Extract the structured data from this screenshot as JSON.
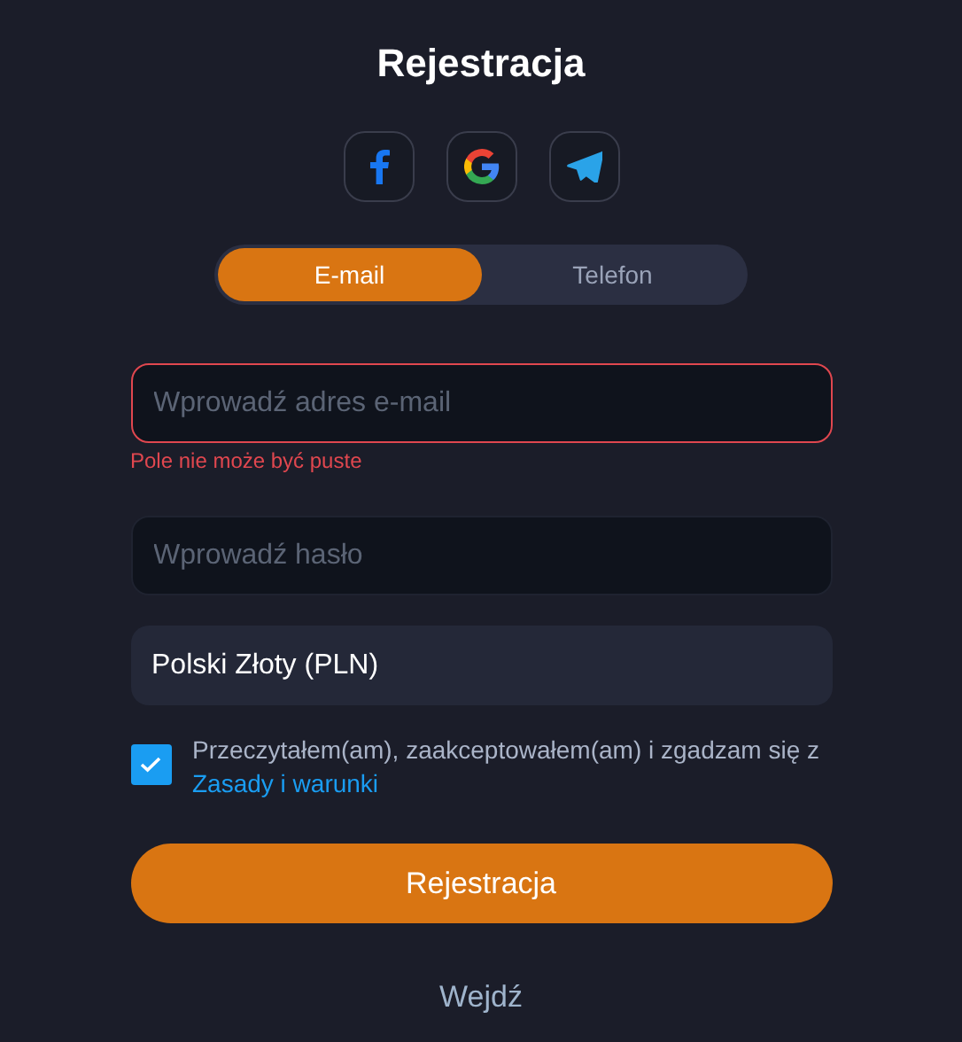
{
  "title": "Rejestracja",
  "social": [
    {
      "kind": "facebook"
    },
    {
      "kind": "google"
    },
    {
      "kind": "telegram"
    }
  ],
  "tabs": [
    {
      "label": "E-mail",
      "selected": true
    },
    {
      "label": "Telefon",
      "selected": false
    }
  ],
  "fields": [
    {
      "kind": "input",
      "placeholder": "Wprowadź adres e-mail",
      "error": "Pole nie może być puste"
    },
    {
      "kind": "input",
      "placeholder": "Wprowadź hasło"
    },
    {
      "kind": "select",
      "value": "Polski Złoty (PLN)"
    }
  ],
  "terms": {
    "checked": true,
    "text": "Przeczytałem(am), zaakceptowałem(am) i zgadzam się z",
    "link": "Zasady i warunki"
  },
  "submit": "Rejestracja",
  "login_link": "Wejdź"
}
